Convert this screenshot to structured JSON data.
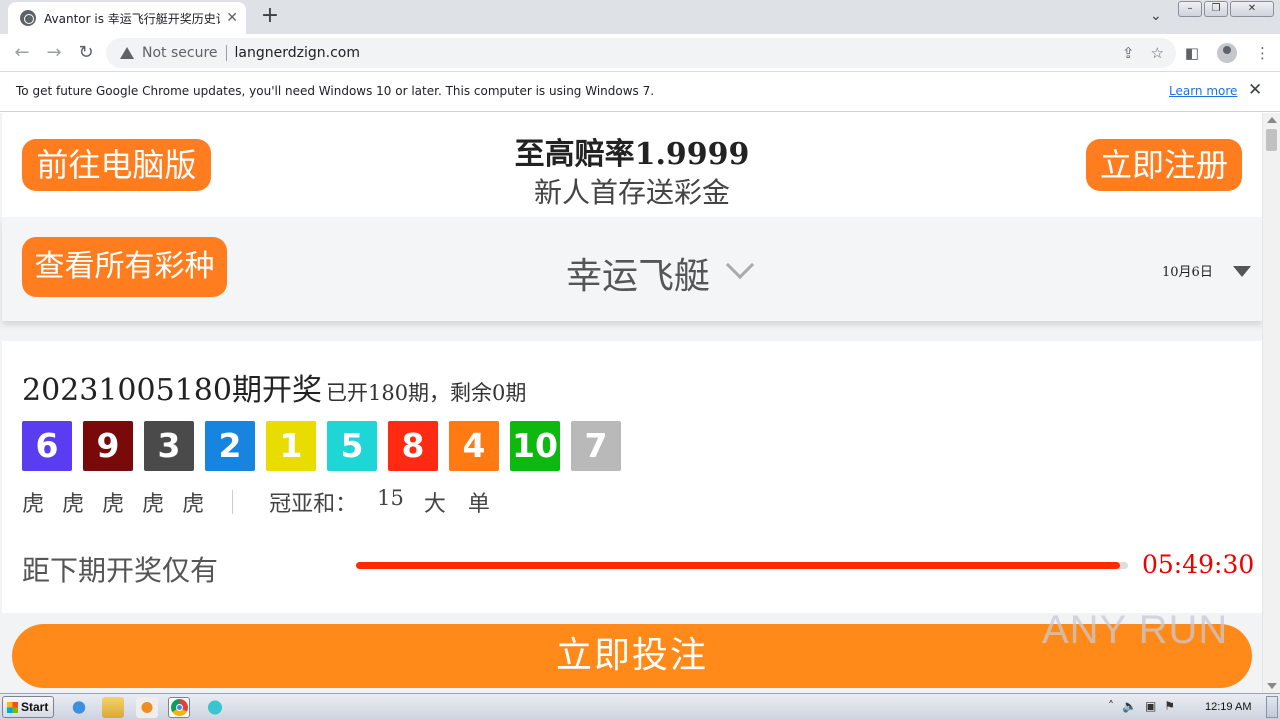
{
  "browser": {
    "tab": {
      "title": "Avantor is 幸运飞行艇开奖历史记录"
    },
    "address": {
      "security": "Not secure",
      "url": "langnerdzign.com"
    },
    "infobar": {
      "message": "To get future Google Chrome updates, you'll need Windows 10 or later. This computer is using Windows 7.",
      "link": "Learn more"
    }
  },
  "promo": {
    "left_button": "前往电脑版",
    "headline": "至高赔率1.9999",
    "subline": "新人首存送彩金",
    "right_button": "立即注册"
  },
  "lottery_bar": {
    "all_games_button": "查看所有彩种",
    "game_name": "幸运飞艇",
    "date": "10月6日"
  },
  "result": {
    "period_title": "20231005180期开奖",
    "period_detail": "已开180期，剩余0期",
    "balls": [
      {
        "number": "6",
        "color": "#5a3df0"
      },
      {
        "number": "9",
        "color": "#7a0a0a"
      },
      {
        "number": "3",
        "color": "#4a4a4a"
      },
      {
        "number": "2",
        "color": "#1784e0"
      },
      {
        "number": "1",
        "color": "#e8dc00"
      },
      {
        "number": "5",
        "color": "#1fd6d6"
      },
      {
        "number": "8",
        "color": "#ff2a12"
      },
      {
        "number": "4",
        "color": "#ff7a12"
      },
      {
        "number": "10",
        "color": "#0fb80f"
      },
      {
        "number": "7",
        "color": "#b9b9b9"
      }
    ],
    "dragon_tiger": [
      "虎",
      "虎",
      "虎",
      "虎",
      "虎"
    ],
    "sum_label": "冠亚和：",
    "sum_value": "15",
    "size": "大",
    "parity": "单",
    "countdown_label": "距下期开奖仅有",
    "countdown_progress": 0.99,
    "countdown_time": "05:49:30"
  },
  "bet_button": "立即投注",
  "watermark": "ANY RUN",
  "taskbar": {
    "start": "Start",
    "clock": "12:19 AM"
  },
  "colors": {
    "accent_orange": "#ff7d1f",
    "timer_red": "#e00000"
  }
}
